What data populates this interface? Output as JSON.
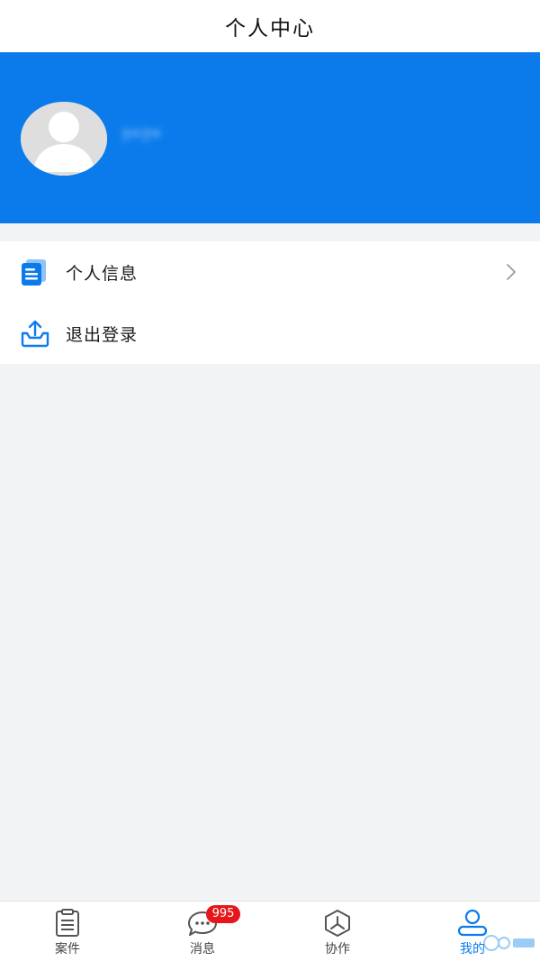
{
  "header": {
    "title": "个人中心"
  },
  "profile": {
    "username_masked": "?*?*"
  },
  "menu": {
    "items": [
      {
        "label": "个人信息",
        "icon": "document-stack-icon"
      },
      {
        "label": "退出登录",
        "icon": "tray-upload-icon"
      }
    ]
  },
  "tabbar": {
    "tabs": [
      {
        "label": "案件",
        "icon": "clipboard-icon"
      },
      {
        "label": "消息",
        "icon": "chat-bubble-icon",
        "badge": "995"
      },
      {
        "label": "协作",
        "icon": "hexagon-branch-icon"
      },
      {
        "label": "我的",
        "icon": "person-icon"
      }
    ],
    "active_index": 3
  },
  "colors": {
    "accent": "#0b7bec",
    "badge": "#e6161a",
    "background": "#f2f3f5"
  }
}
